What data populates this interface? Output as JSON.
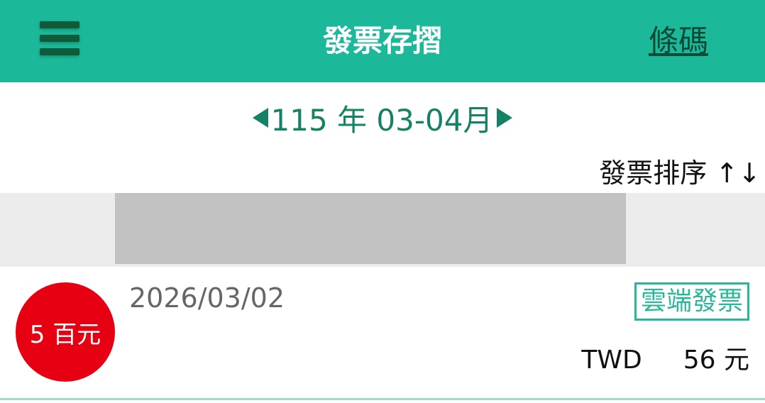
{
  "header": {
    "title": "發票存摺",
    "barcode_label": "條碼"
  },
  "period": {
    "label": "115 年 03-04月"
  },
  "sort": {
    "label": "發票排序 ↑↓"
  },
  "invoices": [
    {
      "badge": "5 百元",
      "date": "2026/03/02",
      "tag": "雲端發票",
      "currency": "TWD",
      "amount": "56 元"
    }
  ],
  "colors": {
    "brand": "#1bb99a",
    "accent_dark": "#158266",
    "badge_red": "#e60012"
  },
  "icons": {
    "menu": "hamburger-icon",
    "prev": "triangle-left-icon",
    "next": "triangle-right-icon"
  }
}
